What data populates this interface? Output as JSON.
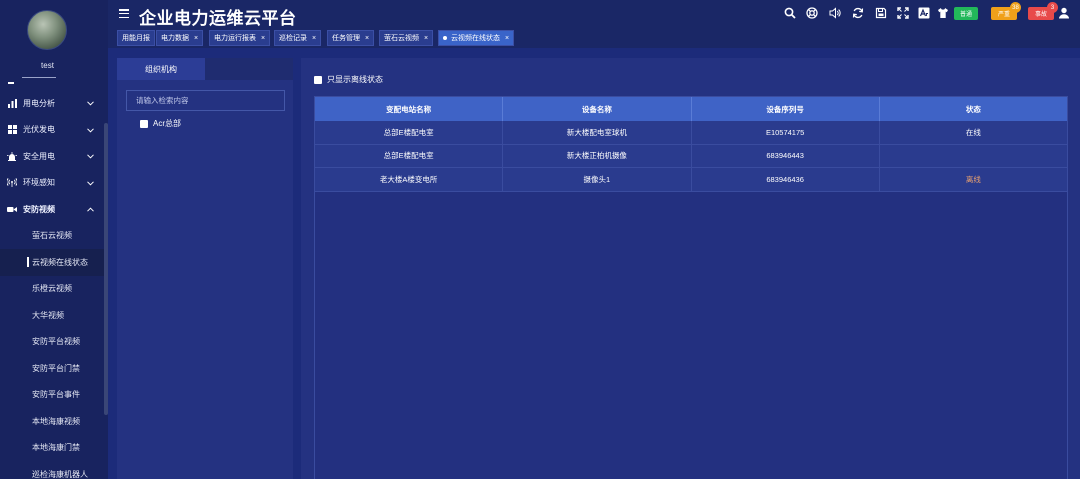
{
  "app": {
    "title": "企业电力运维云平台"
  },
  "user": {
    "name": "test"
  },
  "sidebar": {
    "items": [
      {
        "label": "用电分析",
        "icon": "bar-chart-icon"
      },
      {
        "label": "光伏发电",
        "icon": "solar-grid-icon"
      },
      {
        "label": "安全用电",
        "icon": "alarm-light-icon"
      },
      {
        "label": "环境感知",
        "icon": "signal-icon"
      },
      {
        "label": "安防视频",
        "icon": "video-camera-icon"
      }
    ],
    "subitems": [
      {
        "label": "萤石云视频"
      },
      {
        "label": "云视频在线状态"
      },
      {
        "label": "乐橙云视频"
      },
      {
        "label": "大华视频"
      },
      {
        "label": "安防平台视频"
      },
      {
        "label": "安防平台门禁"
      },
      {
        "label": "安防平台事件"
      },
      {
        "label": "本地海康视频"
      },
      {
        "label": "本地海康门禁"
      },
      {
        "label": "巡检海康机器人"
      }
    ]
  },
  "header": {
    "notify_general": "普通",
    "notify_serious": "严重",
    "notify_serious_count": "38",
    "notify_accident": "事故",
    "notify_accident_count": "3",
    "colors": {
      "general": "#22b85a",
      "serious": "#f0a01a",
      "accident": "#e84a4a"
    }
  },
  "tabs": [
    {
      "label": "用能月报",
      "closable": false
    },
    {
      "label": "电力数据",
      "closable": true
    },
    {
      "label": "电力运行报表",
      "closable": true
    },
    {
      "label": "巡检记录",
      "closable": true
    },
    {
      "label": "任务管理",
      "closable": true
    },
    {
      "label": "萤石云视频",
      "closable": true
    },
    {
      "label": "云视频在线状态",
      "closable": true,
      "active": true
    }
  ],
  "org": {
    "tab_label": "组织机构",
    "search_placeholder": "请输入检索内容",
    "tree": [
      {
        "label": "Acr总部",
        "checked": false
      }
    ]
  },
  "main": {
    "filter_label": "只显示离线状态",
    "columns": [
      "变配电站名称",
      "设备名称",
      "设备序列号",
      "状态"
    ],
    "rows": [
      {
        "station": "总部E楼配电室",
        "device": "新大楼配电室球机",
        "serial": "E10574175",
        "status": "在线",
        "status_color": "#ffffff"
      },
      {
        "station": "总部E楼配电室",
        "device": "新大楼正柏机摄像",
        "serial": "683946443",
        "status": "",
        "status_color": "#ffffff"
      },
      {
        "station": "老大楼A楼变电所",
        "device": "摄像头1",
        "serial": "683946436",
        "status": "离线",
        "status_color": "#e8a070"
      }
    ]
  }
}
